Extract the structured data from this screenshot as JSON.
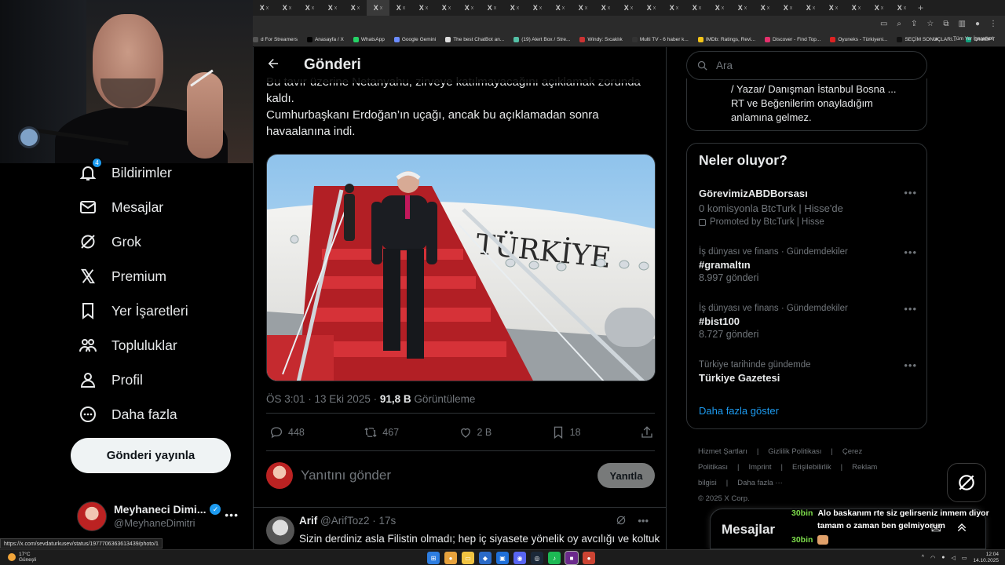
{
  "browser": {
    "tab_count": 29,
    "tab_glyph": "X",
    "tab_close": "x",
    "bookmarks": [
      {
        "label": "d For Streamers",
        "color": "#555"
      },
      {
        "label": "Anasayfa / X",
        "color": "#000"
      },
      {
        "label": "WhatsApp",
        "color": "#25d366"
      },
      {
        "label": "Google Gemini",
        "color": "#6b8cff"
      },
      {
        "label": "The best ChatBot an...",
        "color": "#ddd"
      },
      {
        "label": "(19) Alert Box / Stre...",
        "color": "#54c0a6"
      },
      {
        "label": "Windy: Sıcaklık",
        "color": "#c33"
      },
      {
        "label": "Multi TV - 6 haber k...",
        "color": "#333"
      },
      {
        "label": "IMDb: Ratings, Revi...",
        "color": "#f5c518"
      },
      {
        "label": "Discover - Find Top...",
        "color": "#e4306c"
      },
      {
        "label": "Oyuneks - Türkiyeni...",
        "color": "#d22"
      },
      {
        "label": "SEÇİM SONUÇLARI...",
        "color": "#111"
      },
      {
        "label": "ChatGPT",
        "color": "#10a37f"
      }
    ],
    "bookmarks_more": "»",
    "all_bookmarks": "Tüm Yer İşaretleri"
  },
  "nav": {
    "items": [
      {
        "label": "Bildirimler",
        "icon": "bell-icon",
        "badge": "4"
      },
      {
        "label": "Mesajlar",
        "icon": "mail-icon"
      },
      {
        "label": "Grok",
        "icon": "grok-icon"
      },
      {
        "label": "Premium",
        "icon": "x-logo-icon"
      },
      {
        "label": "Yer İşaretleri",
        "icon": "bookmark-icon"
      },
      {
        "label": "Topluluklar",
        "icon": "communities-icon"
      },
      {
        "label": "Profil",
        "icon": "person-icon"
      },
      {
        "label": "Daha fazla",
        "icon": "more-circle-icon"
      }
    ],
    "post_button": "Gönderi yayınla",
    "account": {
      "name": "Meyhaneci Dimi...",
      "handle": "@MeyhaneDimitri",
      "more": "•••"
    }
  },
  "main": {
    "title": "Gönderi",
    "text_lines": [
      "Bu tavır üzerine Netanyahu, zirveye katılmayacağını açıklamak zorunda",
      "kaldı.",
      "Cumhurbaşkanı Erdoğan’ın uçağı, ancak bu açıklamadan sonra",
      "havaalanına indi."
    ],
    "media_text": "TÜRKİYE",
    "meta": {
      "time": "ÖS 3:01 · 13 Eki 2025 · ",
      "views": "91,8 B",
      "views_label": " Görüntüleme"
    },
    "actions": {
      "replies": "448",
      "reposts": "467",
      "likes": "2 B",
      "bookmarks": "18"
    },
    "reply_placeholder": "Yanıtını gönder",
    "reply_button": "Yanıtla",
    "reply_tweet": {
      "name": "Arif",
      "handle": "@ArifToz2",
      "time": "· 17s",
      "more": "•••",
      "text": "Sizin derdiniz asla Filistin olmadı; hep iç siyasete yönelik oy avcılığı ve koltuk"
    }
  },
  "right": {
    "search_placeholder": "Ara",
    "bio_lines": [
      "/ Yazar/ Danışman İstanbul Bosna ...",
      "RT ve Beğenilerim onayladığım",
      "anlamına gelmez."
    ],
    "trends_title": "Neler oluyor?",
    "trends": [
      {
        "context": "",
        "name": "GörevimizABDBorsası",
        "sub": "0 komisyonla BtcTurk | Hisse'de",
        "promo": "Promoted by BtcTurk | Hisse"
      },
      {
        "context": "İş dünyası ve finans · Gündemdekiler",
        "name": "#gramaltın",
        "sub": "8.997 gönderi"
      },
      {
        "context": "İş dünyası ve finans · Gündemdekiler",
        "name": "#bist100",
        "sub": "8.727 gönderi"
      },
      {
        "context": "Türkiye tarihinde gündemde",
        "name": "Türkiye Gazetesi",
        "sub": ""
      }
    ],
    "trend_more": "•••",
    "show_more": "Daha fazla göster",
    "footer_links": [
      "Hizmet Şartları",
      "|",
      "Gizlilik Politikası",
      "|",
      "Çerez Politikası",
      "|",
      "Imprint",
      "|",
      "Erişilebilirlik",
      "|",
      "Reklam bilgisi",
      "|",
      "Daha fazla ···"
    ],
    "copyright": "© 2025 X Corp.",
    "messages_title": "Mesajlar"
  },
  "overlay_chat": [
    {
      "amount": "30bin",
      "text": "Alo baskanım rte siz gelirseniz inmem diyor"
    },
    {
      "amount": "",
      "text": "tamam o zaman ben gelmiyorum"
    },
    {
      "amount": "30bin",
      "text": ""
    },
    {
      "amount": "30bin",
      "text": ""
    }
  ],
  "status_url": "https://x.com/sevdaturkusev/status/1977706363613439/photo/1",
  "taskbar": {
    "weather_temp": "17°C",
    "weather_label": "Güneşli",
    "time": "12:04",
    "date": "14.10.2025"
  }
}
